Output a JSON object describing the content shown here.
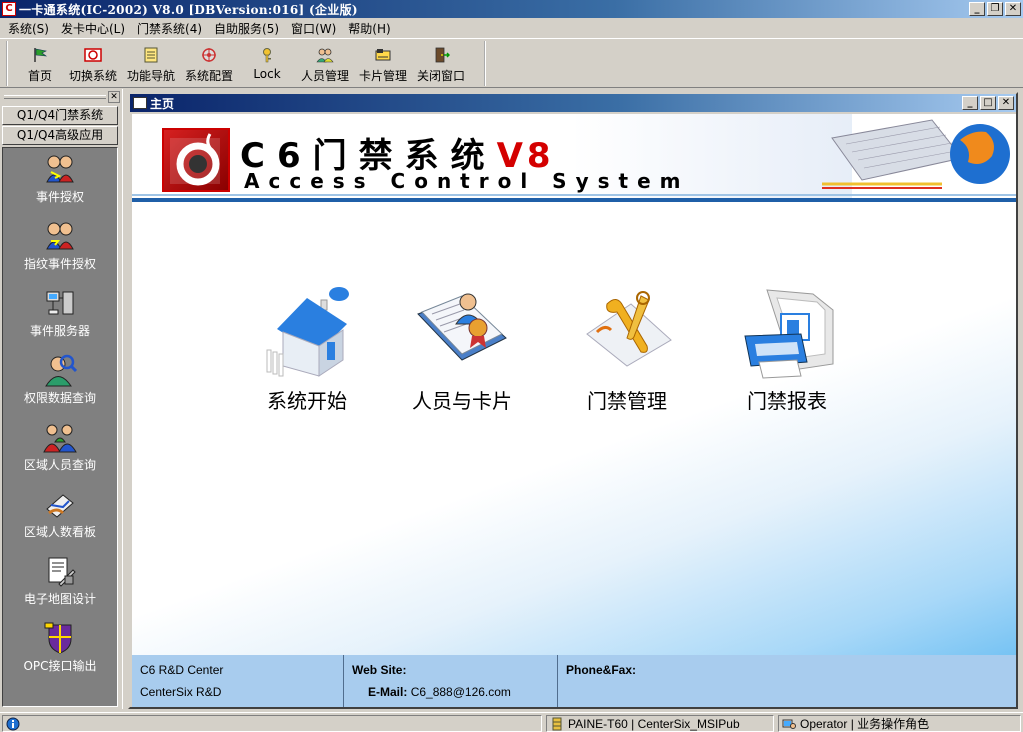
{
  "window": {
    "title": "一卡通系统(IC-2002) V8.0 [DBVersion:016] (企业版)",
    "app_icon_glyph": "C"
  },
  "menu": {
    "items": [
      "系统(S)",
      "发卡中心(L)",
      "门禁系统(4)",
      "自助服务(5)",
      "窗口(W)",
      "帮助(H)"
    ]
  },
  "toolbar": {
    "buttons": [
      {
        "label": "首页",
        "icon": "home-flag-icon"
      },
      {
        "label": "切换系统",
        "icon": "switch-system-icon"
      },
      {
        "label": "功能导航",
        "icon": "navigation-icon"
      },
      {
        "label": "系统配置",
        "icon": "config-icon"
      },
      {
        "label": "Lock",
        "icon": "lock-key-icon"
      },
      {
        "label": "人员管理",
        "icon": "people-icon"
      },
      {
        "label": "卡片管理",
        "icon": "card-icon"
      },
      {
        "label": "关闭窗口",
        "icon": "exit-door-icon"
      }
    ]
  },
  "sidebar": {
    "tabs": [
      "Q1/Q4门禁系统",
      "Q1/Q4高级应用"
    ],
    "items": [
      {
        "label": "事件授权",
        "icon": "event-authorize-icon"
      },
      {
        "label": "指纹事件授权",
        "icon": "fingerprint-authorize-icon"
      },
      {
        "label": "事件服务器",
        "icon": "event-server-icon"
      },
      {
        "label": "权限数据查询",
        "icon": "permission-query-icon"
      },
      {
        "label": "区域人员查询",
        "icon": "area-people-query-icon"
      },
      {
        "label": "区域人数看板",
        "icon": "area-count-board-icon"
      },
      {
        "label": "电子地图设计",
        "icon": "emap-design-icon"
      },
      {
        "label": "OPC接口输出",
        "icon": "opc-output-icon"
      }
    ]
  },
  "mdi": {
    "title": "主页"
  },
  "banner": {
    "title": "C6门禁系统",
    "version": "V8",
    "subtitle": "Access Control System"
  },
  "features": [
    {
      "label": "系统开始",
      "icon": "house-icon"
    },
    {
      "label": "人员与卡片",
      "icon": "people-card-book-icon"
    },
    {
      "label": "门禁管理",
      "icon": "tools-icon"
    },
    {
      "label": "门禁报表",
      "icon": "printer-report-icon"
    }
  ],
  "footer": {
    "company_line1": "C6 R&D Center",
    "company_line2": "CenterSix R&D",
    "website_label": "Web Site:",
    "email_label": "E-Mail:",
    "email_value": "C6_888@126.com",
    "phone_label": "Phone&Fax:"
  },
  "statusbar": {
    "server": "PAINE-T60 | CenterSix_MSIPub",
    "user": "Operator | 业务操作角色"
  },
  "colors": {
    "title_bar": "#0a246a",
    "accent_red": "#d40000",
    "footer_bg": "#a8ccee"
  }
}
